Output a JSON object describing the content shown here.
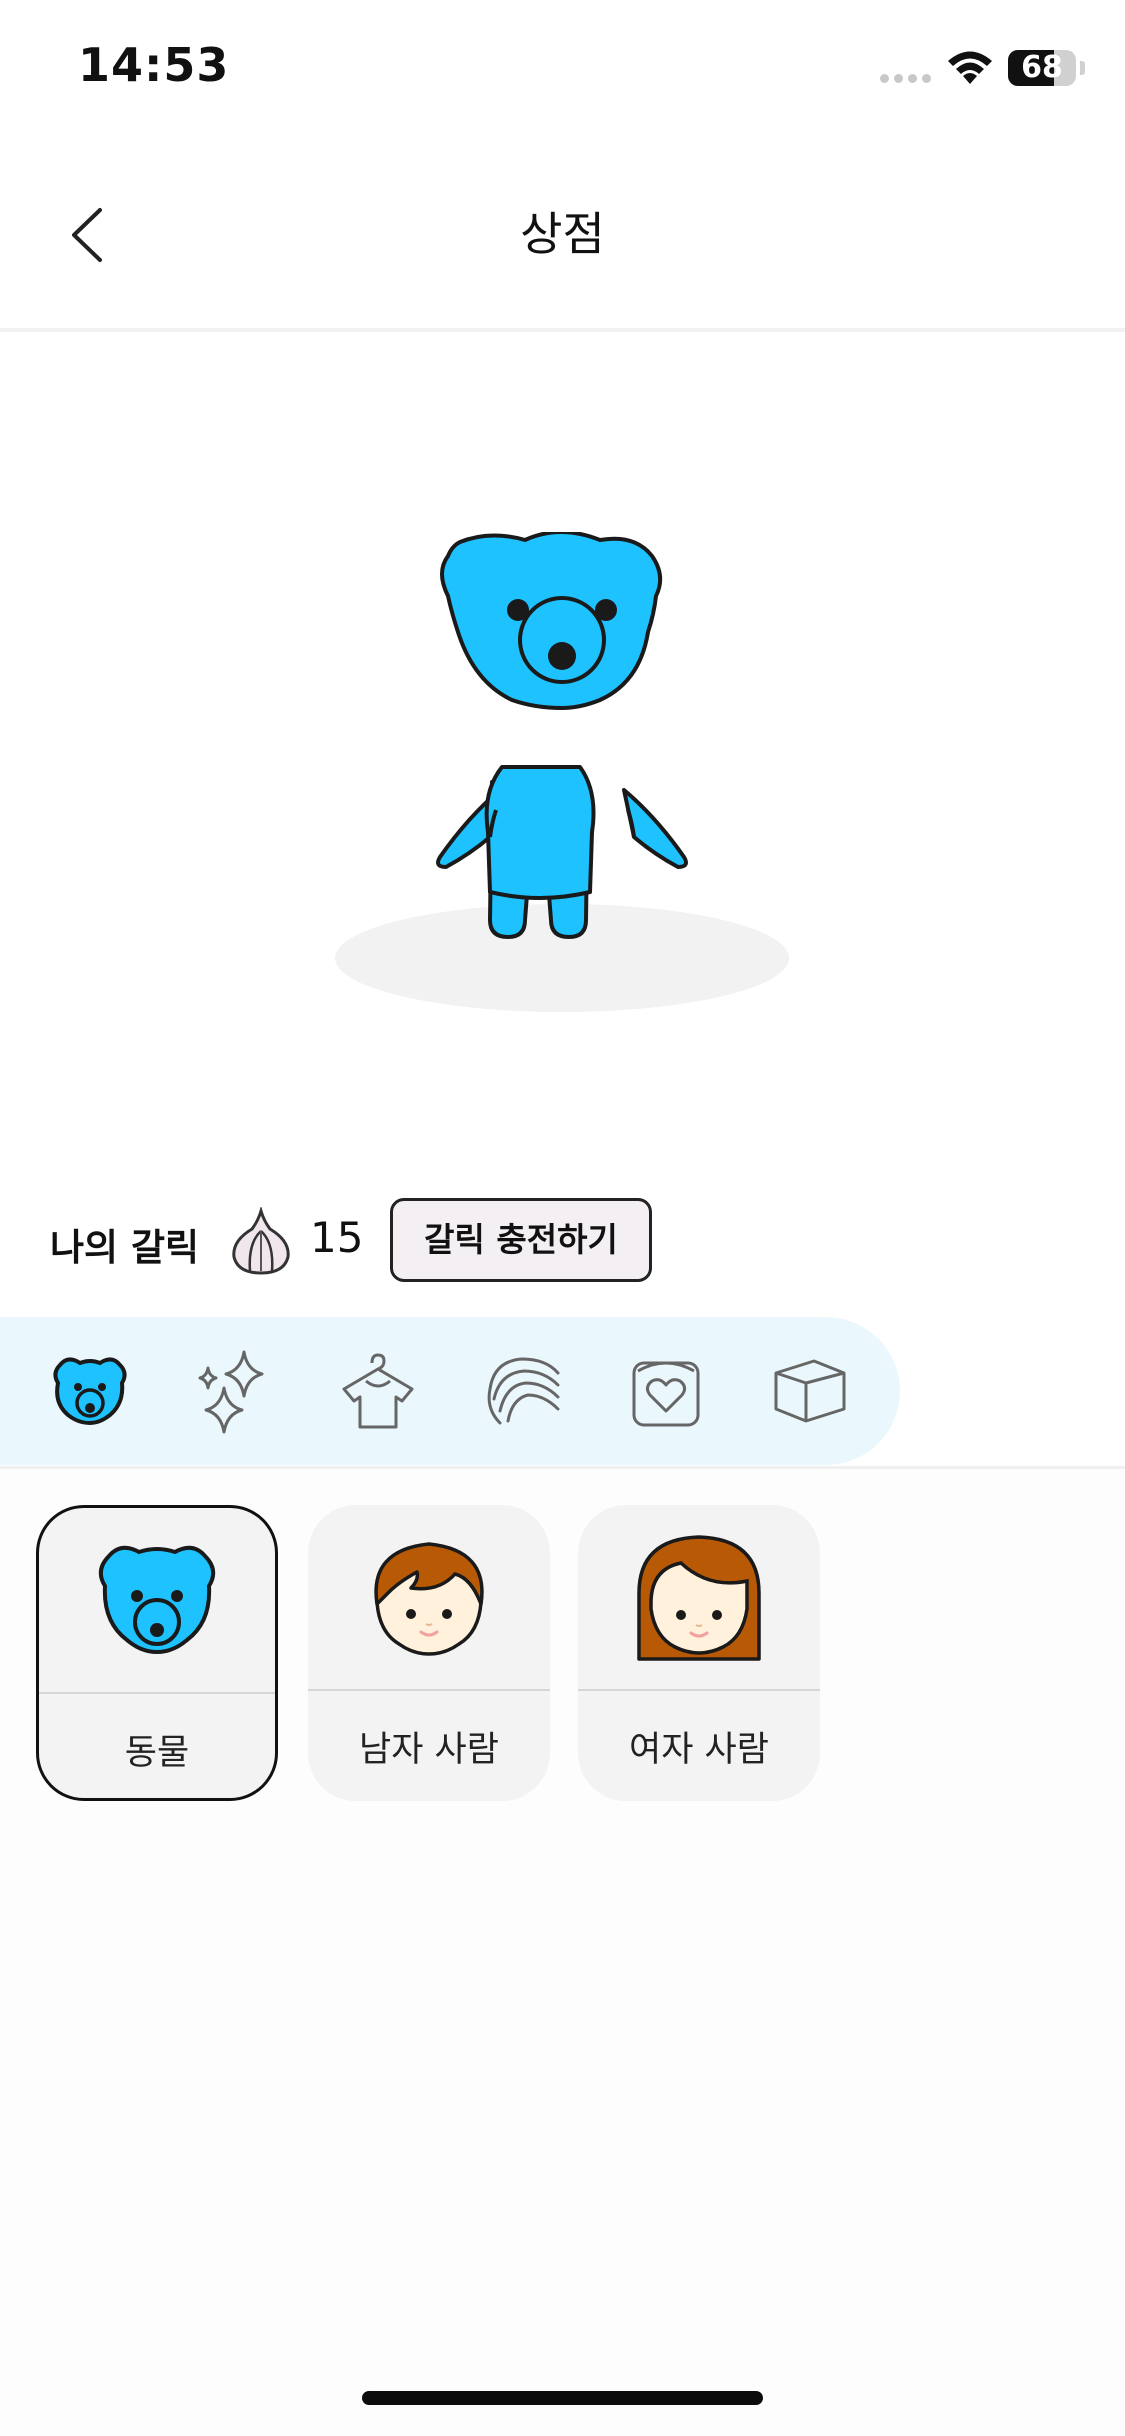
{
  "status_bar": {
    "time": "14:53",
    "battery_level": "68",
    "battery_fraction": 0.68,
    "signal_icon": "cellular-signal-icon",
    "wifi_icon": "wifi-icon"
  },
  "nav": {
    "title": "상점",
    "back_icon": "chevron-left-icon"
  },
  "character": {
    "type": "bear",
    "body_color": "#1dc2ff",
    "outline_color": "#1a1a1a"
  },
  "garlic": {
    "label": "나의 갈릭",
    "icon": "garlic-icon",
    "count": "15",
    "charge_button_label": "갈릭 충전하기"
  },
  "categories": [
    {
      "id": "animal",
      "icon": "bear-icon",
      "selected": true
    },
    {
      "id": "effects",
      "icon": "sparkles-icon",
      "selected": false
    },
    {
      "id": "clothes",
      "icon": "shirt-hanger-icon",
      "selected": false
    },
    {
      "id": "hair",
      "icon": "hair-icon",
      "selected": false
    },
    {
      "id": "items",
      "icon": "heart-bag-icon",
      "selected": false
    },
    {
      "id": "background",
      "icon": "cube-icon",
      "selected": false
    }
  ],
  "items": [
    {
      "label": "동물",
      "icon": "bear-face-icon",
      "selected": true
    },
    {
      "label": "남자 사람",
      "icon": "boy-face-icon",
      "selected": false
    },
    {
      "label": "여자 사람",
      "icon": "girl-face-icon",
      "selected": false
    }
  ],
  "colors": {
    "accent": "#1dc2ff",
    "category_bar_bg": "#eaf8fd",
    "card_bg": "#f3f3f3",
    "hair_brown": "#b85a05",
    "skin": "#fff1dc"
  }
}
